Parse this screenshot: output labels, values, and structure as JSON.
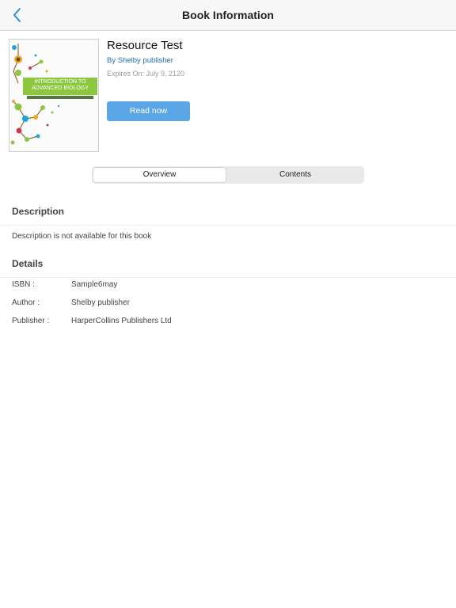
{
  "nav": {
    "title": "Book Information",
    "back_icon": "chevron-left-icon",
    "accent_color": "#2f8fd9"
  },
  "book": {
    "cover_title": "INTRODUCTION TO ADVANCED BIOLOGY",
    "title": "Resource Test",
    "author": "By Shelby publisher",
    "expiry": "Expires On: July 9, 2120",
    "read_button": "Read now"
  },
  "tabs": {
    "overview": "Overview",
    "contents": "Contents",
    "selected": "Overview"
  },
  "description": {
    "heading": "Description",
    "text": "Description is not available for this book"
  },
  "details": {
    "heading": "Details",
    "rows": [
      {
        "label": "ISBN :",
        "value": "Sample6may"
      },
      {
        "label": "Author :",
        "value": "Shelby publisher"
      },
      {
        "label": "Publisher :",
        "value": "HarperCollins Publishers Ltd"
      }
    ]
  },
  "colors": {
    "button": "#5aa6e6",
    "cover_band": "#8dc63f",
    "author_link": "#1b6fb3"
  }
}
